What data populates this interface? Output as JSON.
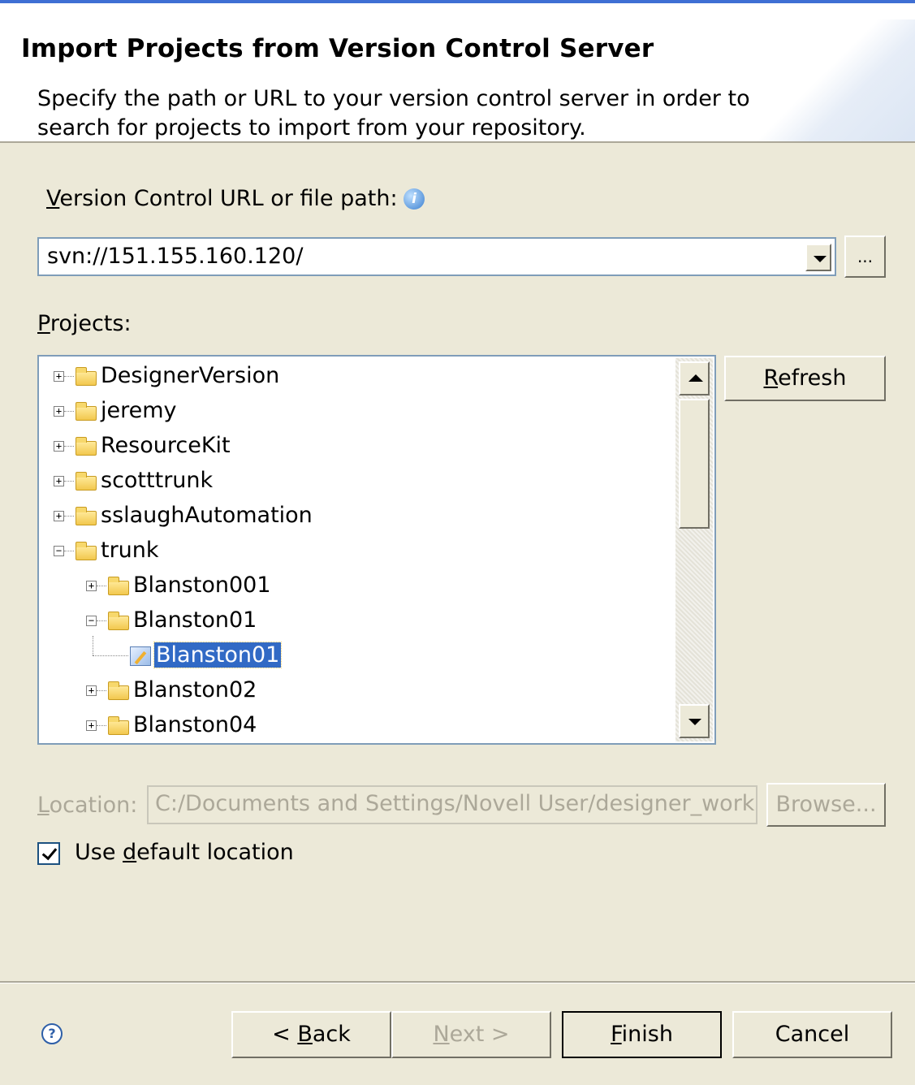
{
  "banner": {
    "title": "Import Projects from Version Control Server",
    "description": "Specify the path or URL to your version control server in order to search for projects to import from your repository."
  },
  "url_field": {
    "label_mnemonic": "V",
    "label_rest": "ersion Control URL or file path:",
    "info_icon": "info-icon",
    "value": "svn://151.155.160.120/",
    "browse_label": "..."
  },
  "projects": {
    "label_mnemonic": "P",
    "label_rest": "rojects:",
    "refresh_mnemonic": "R",
    "refresh_rest": "efresh",
    "tree": [
      {
        "label": "DesignerVersion",
        "level": 0,
        "expander": "+"
      },
      {
        "label": "jeremy",
        "level": 0,
        "expander": "+"
      },
      {
        "label": "ResourceKit",
        "level": 0,
        "expander": "+"
      },
      {
        "label": "scotttrunk",
        "level": 0,
        "expander": "+"
      },
      {
        "label": "sslaughAutomation",
        "level": 0,
        "expander": "+"
      },
      {
        "label": "trunk",
        "level": 0,
        "expander": "-"
      },
      {
        "label": "Blanston001",
        "level": 1,
        "expander": "+"
      },
      {
        "label": "Blanston01",
        "level": 1,
        "expander": "-"
      },
      {
        "label": "Blanston01",
        "level": 2,
        "expander": "",
        "selected": true,
        "icon": "project-icon"
      },
      {
        "label": "Blanston02",
        "level": 1,
        "expander": "+"
      },
      {
        "label": "Blanston04",
        "level": 1,
        "expander": "+"
      }
    ]
  },
  "location": {
    "label_mnemonic": "L",
    "label_rest": "ocation:",
    "value": "C:/Documents and Settings/Novell User/designer_works",
    "browse_label": "Browse...",
    "checkbox_checked": true,
    "checkbox_pre": "Use ",
    "checkbox_mnemonic": "d",
    "checkbox_post": "efault location"
  },
  "footer": {
    "help_icon": "help-icon",
    "back_pre": "< ",
    "back_mnemonic": "B",
    "back_post": "ack",
    "next_mnemonic": "N",
    "next_post": "ext >",
    "finish_mnemonic": "F",
    "finish_post": "inish",
    "cancel_label": "Cancel"
  },
  "colors": {
    "selection": "#316ac5",
    "dialog_bg": "#ece9d8",
    "field_border": "#7f9db9"
  }
}
